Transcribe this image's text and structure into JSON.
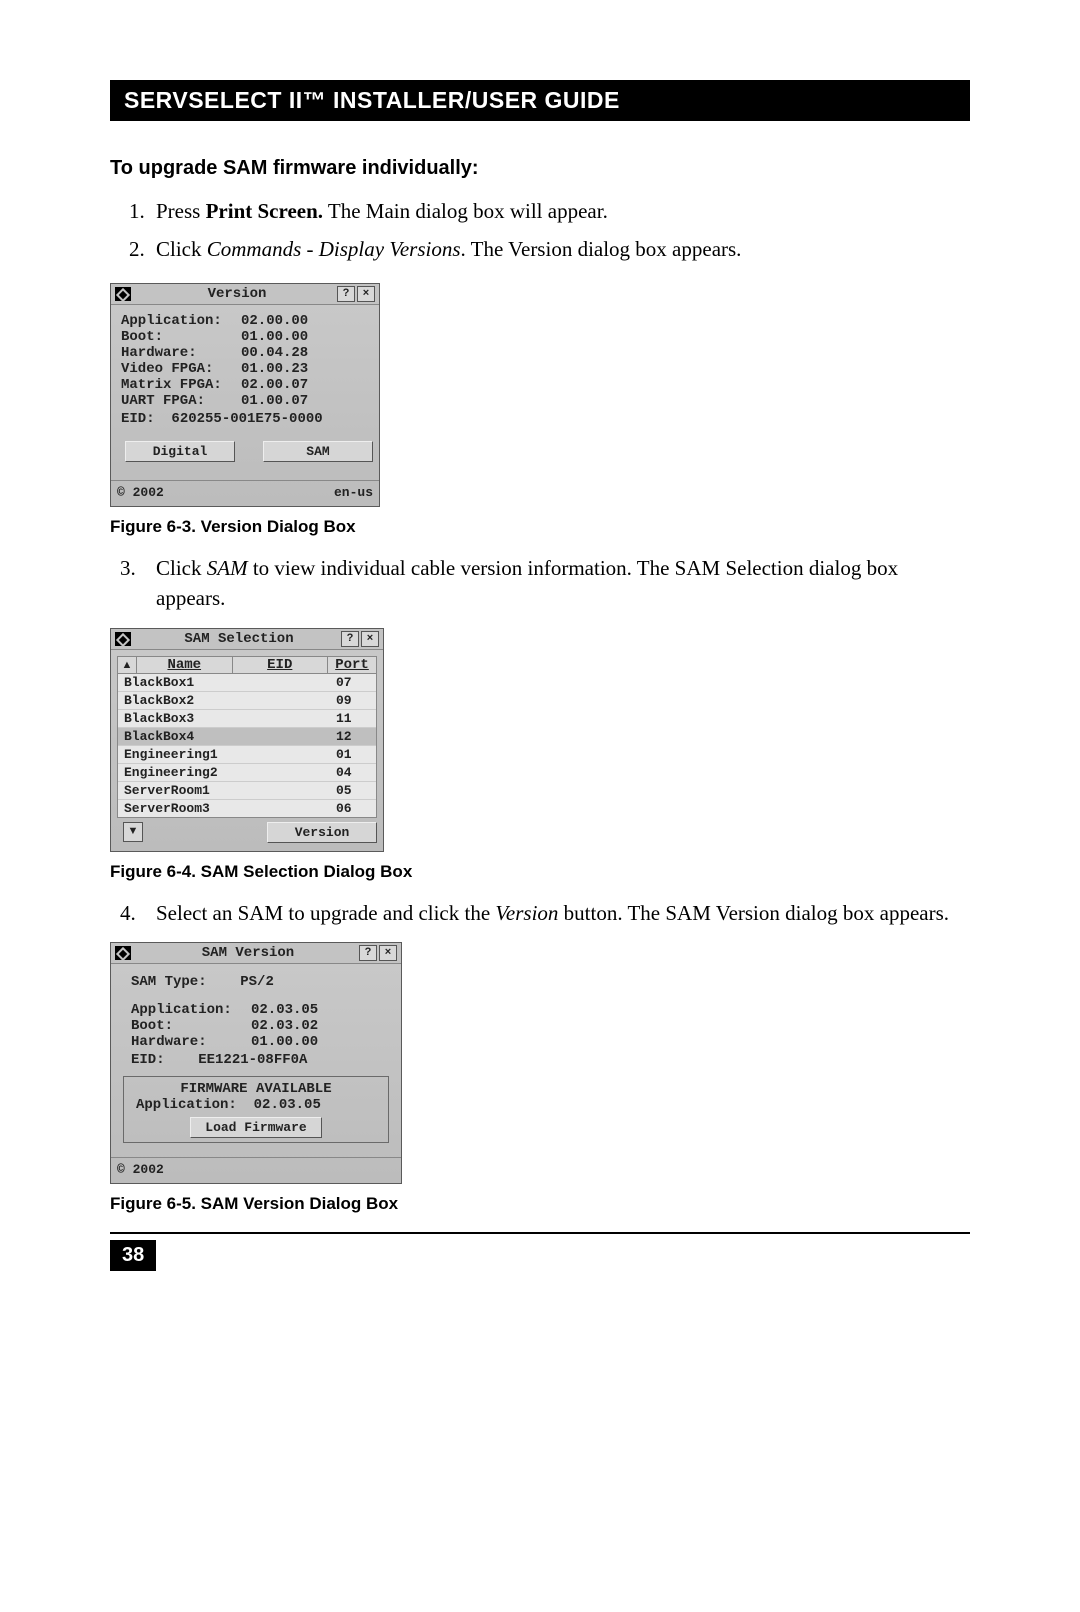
{
  "header": {
    "title": "SERVSELECT II™ INSTALLER/USER GUIDE"
  },
  "section_heading": "To upgrade SAM firmware individually:",
  "steps12": {
    "s1_pre": "Press ",
    "s1_bold": "Print Screen.",
    "s1_post": " The Main dialog box will appear.",
    "s2_pre": "Click ",
    "s2_italic": "Commands - Display Versions",
    "s2_post": ". The Version dialog box appears."
  },
  "dlg_version": {
    "title": "Version",
    "help": "?",
    "close": "×",
    "rows": [
      {
        "label": "Application:",
        "value": "02.00.00"
      },
      {
        "label": "Boot:",
        "value": "01.00.00"
      },
      {
        "label": "Hardware:",
        "value": "00.04.28"
      },
      {
        "label": "Video FPGA:",
        "value": "01.00.23"
      },
      {
        "label": "Matrix FPGA:",
        "value": "02.00.07"
      },
      {
        "label": "UART FPGA:",
        "value": "01.00.07"
      }
    ],
    "eid_label": "EID:",
    "eid_value": "620255-001E75-0000",
    "btn_digital": "Digital",
    "btn_sam": "SAM",
    "copyright": "© 2002",
    "locale": "en-us"
  },
  "caption_6_3": "Figure 6-3. Version Dialog Box",
  "step3": {
    "num": "3.",
    "pre": "Click ",
    "italic": "SAM",
    "post": " to view individual cable version information. The SAM Selection dialog box appears."
  },
  "dlg_sel": {
    "title": "SAM Selection",
    "help": "?",
    "close": "×",
    "arrow_up": "▲",
    "arrow_dn": "▼",
    "col_name": "Name",
    "col_eid": "EID",
    "col_port": "Port",
    "rows": [
      {
        "name": "BlackBox1",
        "eid": "",
        "port": "07"
      },
      {
        "name": "BlackBox2",
        "eid": "",
        "port": "09"
      },
      {
        "name": "BlackBox3",
        "eid": "",
        "port": "11"
      },
      {
        "name": "BlackBox4",
        "eid": "",
        "port": "12"
      },
      {
        "name": "Engineering1",
        "eid": "",
        "port": "01"
      },
      {
        "name": "Engineering2",
        "eid": "",
        "port": "04"
      },
      {
        "name": "ServerRoom1",
        "eid": "",
        "port": "05"
      },
      {
        "name": "ServerRoom3",
        "eid": "",
        "port": "06"
      }
    ],
    "btn_version": "Version"
  },
  "caption_6_4": "Figure 6-4. SAM Selection Dialog Box",
  "step4": {
    "num": "4.",
    "pre": "Select an SAM to upgrade and click the ",
    "italic": "Version",
    "post": " button. The SAM Version dialog box appears."
  },
  "dlg_sv": {
    "title": "SAM Version",
    "help": "?",
    "close": "×",
    "type_label": "SAM Type:",
    "type_value": "PS/2",
    "rows": [
      {
        "label": "Application:",
        "value": "02.03.05"
      },
      {
        "label": "Boot:",
        "value": "02.03.02"
      },
      {
        "label": "Hardware:",
        "value": "01.00.00"
      }
    ],
    "eid_label": "EID:",
    "eid_value": "EE1221-08FF0A",
    "fw_header": "FIRMWARE AVAILABLE",
    "fw_app_label": "Application:",
    "fw_app_value": "02.03.05",
    "btn_load": "Load Firmware",
    "copyright": "© 2002"
  },
  "caption_6_5": "Figure 6-5. SAM Version Dialog Box",
  "page_number": "38"
}
